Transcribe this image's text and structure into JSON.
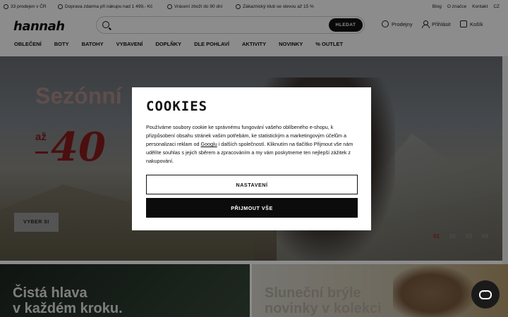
{
  "topbar": {
    "items": [
      {
        "label": "33 prodejen v ČR",
        "icon": "pin-icon"
      },
      {
        "label": "Doprava zdarma při nákupu nad 1 499,- Kč",
        "icon": "truck-icon"
      },
      {
        "label": "Vrácení zboží do 90 dní",
        "icon": "return-icon"
      },
      {
        "label": "Zákaznický klub se slevou až 15 %",
        "icon": "club-icon"
      }
    ],
    "links": [
      "Blog",
      "O značce",
      "Kontakt",
      "CZ"
    ]
  },
  "header": {
    "logo": "hannah",
    "search_placeholder": "",
    "search_button": "HLEDAT",
    "stores": "Prodejny",
    "login": "Přihlásit",
    "cart": "Košík"
  },
  "nav": [
    "OBLEČENÍ",
    "BOTY",
    "BATOHY",
    "VYBAVENÍ",
    "DOPLŇKY",
    "DLE POHLAVÍ",
    "AKTIVITY",
    "NOVINKY",
    "% OUTLET"
  ],
  "hero": {
    "title": "Sezónní",
    "az": "až",
    "discount": "40",
    "button": "VYBER SI",
    "pager": [
      "01",
      "02",
      "03",
      "04"
    ],
    "active_page": "01"
  },
  "banners": {
    "left": {
      "line1": "Čistá hlava",
      "line2": "v každém kroku."
    },
    "right": {
      "line1": "Sluneční brýle",
      "line2": "novinky v kolekci"
    }
  },
  "cookies": {
    "title": "COOKIES",
    "text_before": "Používáme soubory cookie ke správnému fungování vašeho oblíbeného e-shopu, k přizpůsobení obsahu stránek vašim potřebám, ke statistickým a marketingovým účelům a personalizaci reklam od ",
    "link": "Googlu",
    "text_after": " i dalších společností. Kliknutím na tlačítko Přijmout vše nám udělíte souhlas s jejich sběrem a zpracováním a my vám poskytneme ten nejlepší zážitek z nakupování.",
    "settings_button": "NASTAVENÍ",
    "accept_button": "PŘIJMOUT VŠE"
  },
  "colors": {
    "accent": "#8a1c1c",
    "dark": "#111111",
    "overlay": "rgba(0,0,0,0.45)"
  }
}
